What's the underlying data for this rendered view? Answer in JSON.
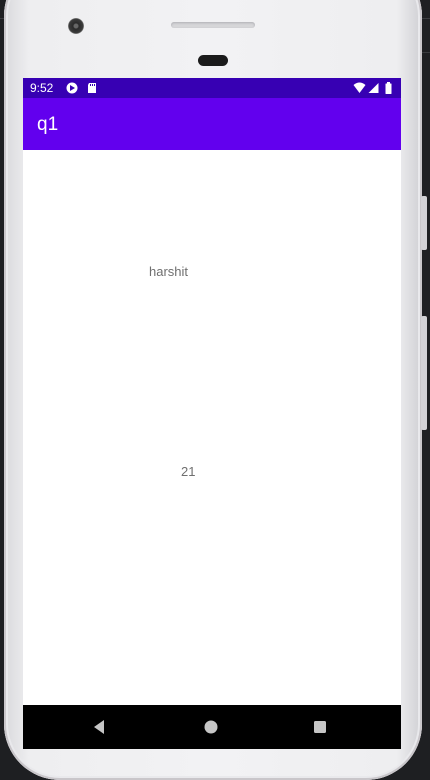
{
  "status_bar": {
    "time": "9:52",
    "icons": [
      "play-store-icon",
      "sd-card-icon",
      "wifi-icon",
      "signal-icon",
      "battery-icon"
    ]
  },
  "app_bar": {
    "title": "q1"
  },
  "content": {
    "name_text": "harshit",
    "age_text": "21"
  },
  "nav_bar": {
    "buttons": [
      "back-icon",
      "home-icon",
      "recents-icon"
    ]
  },
  "colors": {
    "status_bar": "#3700b3",
    "app_bar": "#6200ee",
    "content_text": "#6f6f6f",
    "nav_bar": "#000000"
  }
}
